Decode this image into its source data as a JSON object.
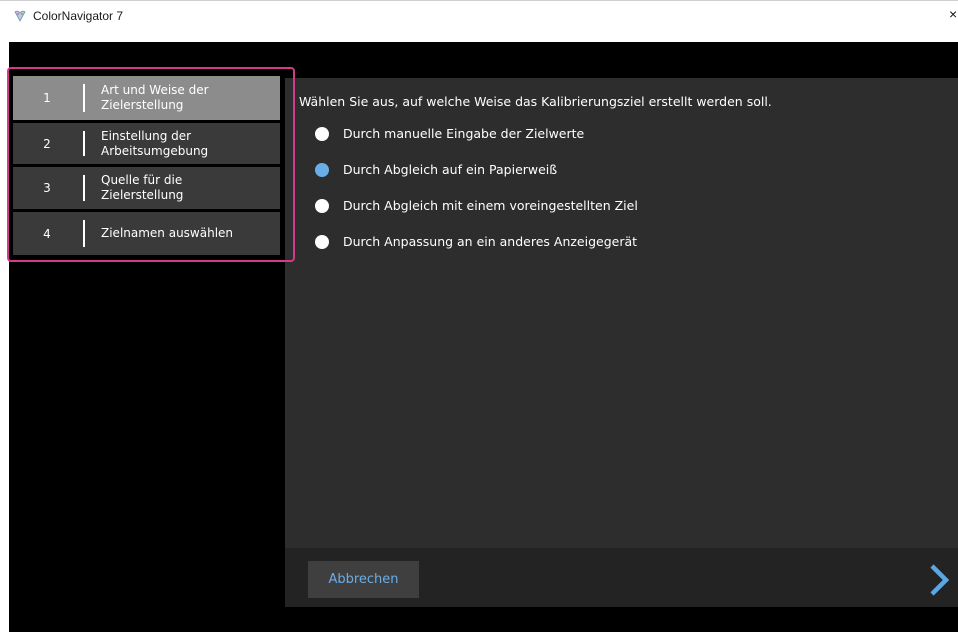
{
  "window": {
    "title": "ColorNavigator 7",
    "close_glyph": "×",
    "icon": "colornavigator-icon"
  },
  "steps": [
    {
      "number": "1",
      "label": "Art und Weise der\nZielerstellung",
      "active": true
    },
    {
      "number": "2",
      "label": "Einstellung der\nArbeitsumgebung",
      "active": false
    },
    {
      "number": "3",
      "label": "Quelle für die\nZielerstellung",
      "active": false
    },
    {
      "number": "4",
      "label": "Zielnamen auswählen",
      "active": false
    }
  ],
  "main": {
    "instruction": "Wählen Sie aus, auf welche Weise das Kalibrierungsziel erstellt werden soll.",
    "options": [
      {
        "label": "Durch manuelle Eingabe der Zielwerte",
        "selected": false
      },
      {
        "label": "Durch Abgleich auf ein Papierweiß",
        "selected": true
      },
      {
        "label": "Durch Abgleich mit einem voreingestellten Ziel",
        "selected": false
      },
      {
        "label": "Durch Anpassung an ein anderes Anzeigegerät",
        "selected": false
      }
    ]
  },
  "footer": {
    "cancel_label": "Abbrechen",
    "next_icon": "chevron-right-icon"
  },
  "colors": {
    "accent": "#6aaee8",
    "highlight_frame": "#d6388d",
    "active_step": "#8c8c8c",
    "step_bg": "#3a3a3a",
    "panel_bg": "#2d2d2d",
    "footer_bg": "#232323",
    "background": "#000000"
  }
}
